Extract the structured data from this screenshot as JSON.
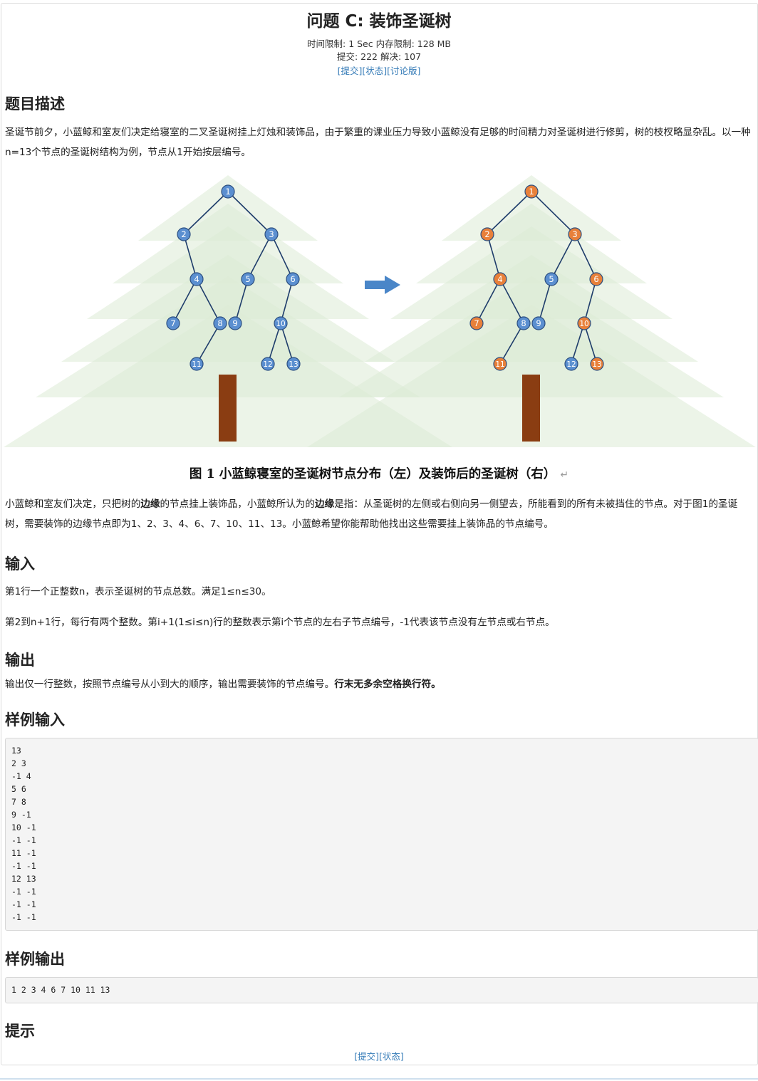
{
  "problem": {
    "title": "问题 C: 装饰圣诞树",
    "limits_line1": "时间限制: 1 Sec  内存限制: 128 MB",
    "limits_line2": "提交: 222  解决: 107",
    "top_links": [
      "[提交]",
      "[状态]",
      "[讨论版]"
    ]
  },
  "sections": {
    "description_heading": "题目描述",
    "description_text": "圣诞节前夕，小蓝鲸和室友们决定给寝室的二叉圣诞树挂上灯烛和装饰品，由于繁重的课业压力导致小蓝鲸没有足够的时间精力对圣诞树进行修剪，树的枝杈略显杂乱。以一种n=13个节点的圣诞树结构为例，节点从1开始按层编号。",
    "figure_caption": "图 1  小蓝鲸寝室的圣诞树节点分布（左）及装饰后的圣诞树（右）",
    "figure_caption_mark": "↵",
    "rule_part1": "小蓝鲸和室友们决定，只把树的",
    "rule_bold1": "边缘",
    "rule_part2": "的节点挂上装饰品，小蓝鲸所认为的",
    "rule_bold2": "边缘",
    "rule_part3": "是指：从圣诞树的左侧或右侧向另一侧望去，所能看到的所有未被挡住的节点。对于图1的圣诞树，需要装饰的边缘节点即为1、2、3、4、6、7、10、11、13。小蓝鲸希望你能帮助他找出这些需要挂上装饰品的节点编号。",
    "input_heading": "输入",
    "input_line1": "第1行一个正整数n，表示圣诞树的节点总数。满足1≤n≤30。",
    "input_line2": "第2到n+1行，每行有两个整数。第i+1(1≤i≤n)行的整数表示第i个节点的左右子节点编号，-1代表该节点没有左节点或右节点。",
    "output_heading": "输出",
    "output_text": "输出仅一行整数，按照节点编号从小到大的顺序，输出需要装饰的节点编号。",
    "output_bold": "行末无多余空格换行符。",
    "sample_input_heading": "样例输入",
    "sample_input": "13\n2 3\n-1 4\n5 6\n7 8\n9 -1\n10 -1\n-1 -1\n11 -1\n-1 -1\n12 13\n-1 -1\n-1 -1\n-1 -1",
    "sample_output_heading": "样例输出",
    "sample_output": "1 2 3 4 6 7 10 11 13",
    "hint_heading": "提示",
    "bottom_links": [
      "[提交]",
      "[状态]"
    ]
  },
  "figure": {
    "node_labels": [
      "1",
      "2",
      "3",
      "4",
      "5",
      "6",
      "7",
      "8",
      "9",
      "10",
      "11",
      "12",
      "13"
    ],
    "decorated_nodes": [
      "1",
      "2",
      "3",
      "4",
      "6",
      "7",
      "10",
      "11",
      "13"
    ],
    "colors": {
      "node_plain": "#5b8fd0",
      "node_decorated": "#e8803a",
      "tree_foliage": "#dcebd6",
      "trunk": "#8a3d12",
      "arrow": "#4a86c8",
      "edge": "#1f3d6b"
    }
  }
}
